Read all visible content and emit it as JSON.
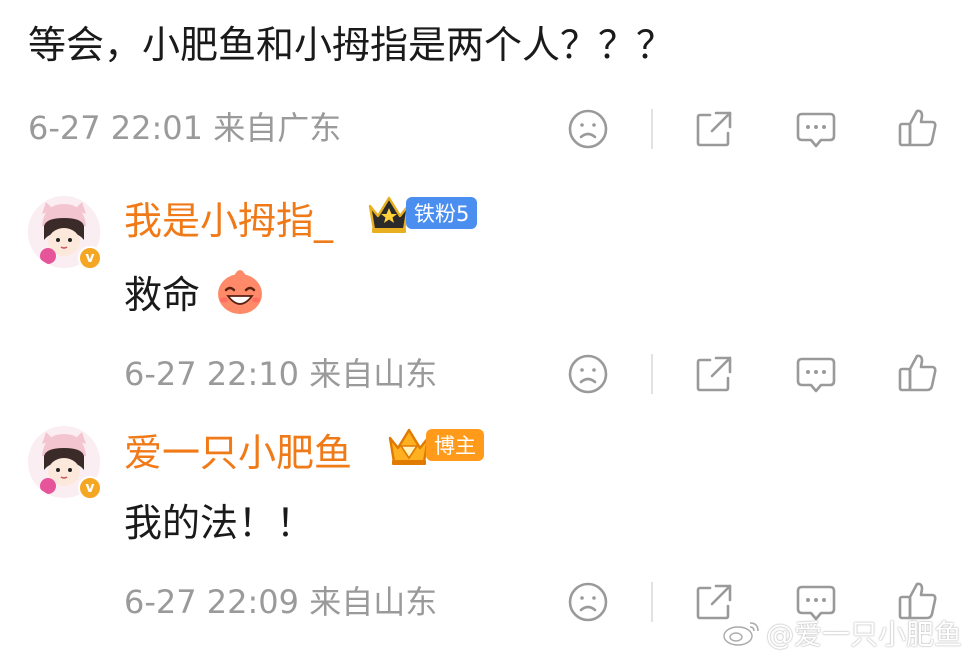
{
  "parent_comment": {
    "text": "等会，小肥鱼和小拇指是两个人？？？",
    "meta": "6-27 22:01 来自广东"
  },
  "replies": [
    {
      "name": "我是小拇指_",
      "badge": "铁粉5",
      "text": "救命",
      "meta": "6-27 22:10 来自山东"
    },
    {
      "name": "爱一只小肥鱼",
      "badge": "博主",
      "text": "我的法！！",
      "meta": "6-27 22:09 来自山东"
    }
  ],
  "verified_mark": "v",
  "watermark": "@爱一只小肥鱼",
  "icons": {
    "dislike": "sad-face-icon",
    "share": "share-icon",
    "comment": "comment-icon",
    "like": "thumbs-up-icon"
  },
  "colors": {
    "name": "#f07a18",
    "meta": "#9a9a9a",
    "fan_tag": "#4a8ef0",
    "owner_tag": "#ff9a1a"
  }
}
